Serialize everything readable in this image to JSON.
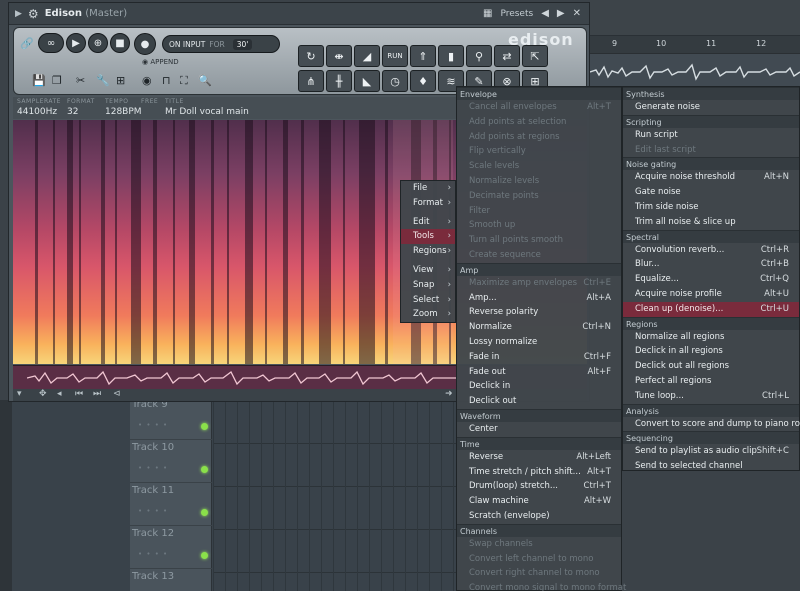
{
  "window": {
    "title": "Edison",
    "subtitle": "(Master)",
    "presets_label": "Presets"
  },
  "toolbar": {
    "on_input_label": "ON INPUT",
    "for_label": "FOR",
    "duration_value": "30'",
    "append_label": "APPEND",
    "logo_text": "edison",
    "run_label": "RUN"
  },
  "info": {
    "samplerate_label": "SAMPLERATE",
    "samplerate_value": "44100Hz",
    "format_label": "FORMAT",
    "format_value": "32",
    "tempo_label": "TEMPO",
    "tempo_value": "128BPM",
    "free_label": "FREE",
    "title_label": "TITLE",
    "title_value": "Mr Doll vocal main"
  },
  "timeline": {
    "ticks": [
      "9",
      "10",
      "11",
      "12"
    ]
  },
  "tracks": [
    {
      "name": "Track 9"
    },
    {
      "name": "Track 10"
    },
    {
      "name": "Track 11"
    },
    {
      "name": "Track 12"
    },
    {
      "name": "Track 13"
    }
  ],
  "main_menu": {
    "items": [
      {
        "label": "File"
      },
      {
        "label": "Format"
      },
      {
        "label": "Edit"
      },
      {
        "label": "Tools"
      },
      {
        "label": "Regions"
      },
      {
        "label": "View"
      },
      {
        "label": "Snap"
      },
      {
        "label": "Select"
      },
      {
        "label": "Zoom"
      }
    ]
  },
  "tools_menu": {
    "envelope_header": "Envelope",
    "envelope_items": [
      {
        "label": "Cancel all envelopes",
        "shortcut": "Alt+T"
      },
      {
        "label": "Add points at selection",
        "shortcut": ""
      },
      {
        "label": "Add points at regions",
        "shortcut": ""
      },
      {
        "label": "Flip vertically",
        "shortcut": ""
      },
      {
        "label": "Scale levels",
        "shortcut": ""
      },
      {
        "label": "Normalize levels",
        "shortcut": ""
      },
      {
        "label": "Decimate points",
        "shortcut": ""
      },
      {
        "label": "Filter",
        "shortcut": ""
      },
      {
        "label": "Smooth up",
        "shortcut": ""
      },
      {
        "label": "Turn all points smooth",
        "shortcut": ""
      },
      {
        "label": "Create sequence",
        "shortcut": ""
      }
    ],
    "amp_header": "Amp",
    "amp_items": [
      {
        "label": "Maximize amp envelopes",
        "shortcut": "Ctrl+E",
        "disabled": true
      },
      {
        "label": "Amp...",
        "shortcut": "Alt+A",
        "disabled": false
      },
      {
        "label": "Reverse polarity",
        "shortcut": "",
        "disabled": false
      },
      {
        "label": "Normalize",
        "shortcut": "Ctrl+N",
        "disabled": false
      },
      {
        "label": "Lossy normalize",
        "shortcut": "",
        "disabled": false
      },
      {
        "label": "Fade in",
        "shortcut": "Ctrl+F",
        "disabled": false
      },
      {
        "label": "Fade out",
        "shortcut": "Alt+F",
        "disabled": false
      },
      {
        "label": "Declick in",
        "shortcut": "",
        "disabled": false
      },
      {
        "label": "Declick out",
        "shortcut": "",
        "disabled": false
      }
    ],
    "waveform_header": "Waveform",
    "waveform_items": [
      {
        "label": "Center",
        "shortcut": ""
      }
    ],
    "time_header": "Time",
    "time_items": [
      {
        "label": "Reverse",
        "shortcut": "Alt+Left"
      },
      {
        "label": "Time stretch / pitch shift...",
        "shortcut": "Alt+T"
      },
      {
        "label": "Drum(loop) stretch...",
        "shortcut": "Ctrl+T"
      },
      {
        "label": "Claw machine",
        "shortcut": "Alt+W"
      },
      {
        "label": "Scratch (envelope)",
        "shortcut": ""
      }
    ],
    "channels_header": "Channels",
    "channels_items": [
      {
        "label": "Swap channels",
        "shortcut": ""
      },
      {
        "label": "Convert left channel to mono",
        "shortcut": ""
      },
      {
        "label": "Convert right channel to mono",
        "shortcut": ""
      },
      {
        "label": "Convert mono signal to mono format",
        "shortcut": ""
      }
    ]
  },
  "right_menu": {
    "synthesis_header": "Synthesis",
    "synthesis_items": [
      {
        "label": "Generate noise",
        "shortcut": ""
      }
    ],
    "scripting_header": "Scripting",
    "scripting_items": [
      {
        "label": "Run script",
        "shortcut": "",
        "disabled": false
      },
      {
        "label": "Edit last script",
        "shortcut": "",
        "disabled": true
      }
    ],
    "noise_header": "Noise gating",
    "noise_items": [
      {
        "label": "Acquire noise threshold",
        "shortcut": "Alt+N"
      },
      {
        "label": "Gate noise",
        "shortcut": ""
      },
      {
        "label": "Trim side noise",
        "shortcut": ""
      },
      {
        "label": "Trim all noise & slice up",
        "shortcut": ""
      }
    ],
    "spectral_header": "Spectral",
    "spectral_items": [
      {
        "label": "Convolution reverb...",
        "shortcut": "Ctrl+R",
        "highlight": false
      },
      {
        "label": "Blur...",
        "shortcut": "Ctrl+B",
        "highlight": false
      },
      {
        "label": "Equalize...",
        "shortcut": "Ctrl+Q",
        "highlight": false
      },
      {
        "label": "Acquire noise profile",
        "shortcut": "Alt+U",
        "highlight": false
      },
      {
        "label": "Clean up (denoise)...",
        "shortcut": "Ctrl+U",
        "highlight": true
      }
    ],
    "regions_header": "Regions",
    "regions_items": [
      {
        "label": "Normalize all regions",
        "shortcut": ""
      },
      {
        "label": "Declick in all regions",
        "shortcut": ""
      },
      {
        "label": "Declick out all regions",
        "shortcut": ""
      },
      {
        "label": "Perfect all regions",
        "shortcut": ""
      },
      {
        "label": "Tune loop...",
        "shortcut": "Ctrl+L"
      }
    ],
    "analysis_header": "Analysis",
    "analysis_items": [
      {
        "label": "Convert to score and dump to piano roll",
        "shortcut": ""
      }
    ],
    "sequencing_header": "Sequencing",
    "sequencing_items": [
      {
        "label": "Send to playlist as audio clip",
        "shortcut": "Shift+C"
      },
      {
        "label": "Send to selected channel",
        "shortcut": ""
      }
    ]
  },
  "colors": {
    "highlight": "#7a2b3c",
    "menu_bg": "#40464b",
    "led_green": "#8ae04a"
  }
}
